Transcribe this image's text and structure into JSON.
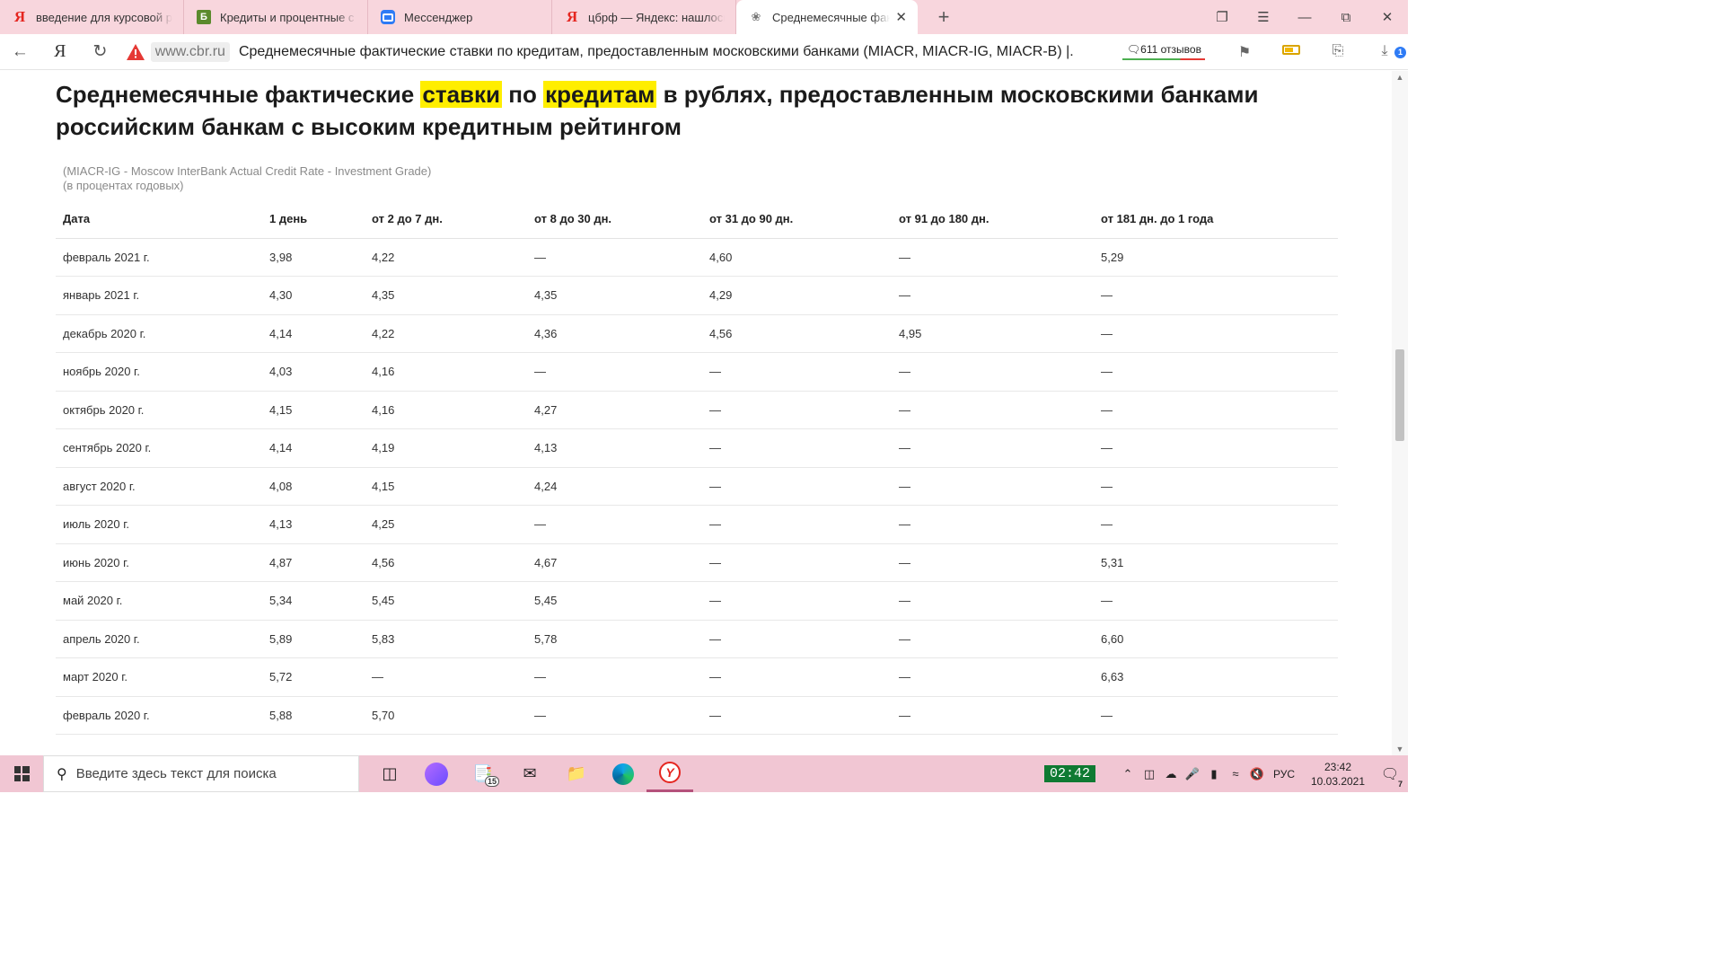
{
  "browser": {
    "tabs": [
      {
        "icon": "yandex-icon",
        "title": "введение для курсовой р",
        "active": false
      },
      {
        "icon": "banki-icon",
        "title": "Кредиты и процентные с",
        "active": false
      },
      {
        "icon": "messenger-icon",
        "title": "Мессенджер",
        "active": false
      },
      {
        "icon": "yandex-icon",
        "title": "цбрф — Яндекс: нашлось",
        "active": false
      },
      {
        "icon": "cbr-eagle-icon",
        "title": "Среднемесячные факт",
        "active": true
      }
    ],
    "new_tab_label": "+",
    "address": {
      "domain": "www.cbr.ru",
      "page_title": "Среднемесячные фактические ставки по кредитам, предоставленным московскими банками (MIACR, MIACR-IG, MIACR-B) |..."
    },
    "reviews_label": "611 отзывов"
  },
  "page": {
    "heading_parts": [
      "Среднемесячные фактические ",
      "ставки",
      " по ",
      "кредитам",
      " в рублях, предоставленным московскими банками российским банкам с высоким кредитным рейтингом"
    ],
    "subnote_line1": "(MIACR-IG - Moscow InterBank Actual Credit Rate - Investment Grade)",
    "subnote_line2": "(в процентах годовых)",
    "highlight_color": "#ffee00",
    "table": {
      "columns": [
        "Дата",
        "1 день",
        "от 2 до 7 дн.",
        "от 8 до 30 дн.",
        "от 31 до 90 дн.",
        "от 91 до 180 дн.",
        "от 181 дн. до 1 года"
      ],
      "rows": [
        [
          "февраль 2021 г.",
          "3,98",
          "4,22",
          "—",
          "4,60",
          "—",
          "5,29"
        ],
        [
          "январь 2021 г.",
          "4,30",
          "4,35",
          "4,35",
          "4,29",
          "—",
          "—"
        ],
        [
          "декабрь 2020 г.",
          "4,14",
          "4,22",
          "4,36",
          "4,56",
          "4,95",
          "—"
        ],
        [
          "ноябрь 2020 г.",
          "4,03",
          "4,16",
          "—",
          "—",
          "—",
          "—"
        ],
        [
          "октябрь 2020 г.",
          "4,15",
          "4,16",
          "4,27",
          "—",
          "—",
          "—"
        ],
        [
          "сентябрь 2020 г.",
          "4,14",
          "4,19",
          "4,13",
          "—",
          "—",
          "—"
        ],
        [
          "август 2020 г.",
          "4,08",
          "4,15",
          "4,24",
          "—",
          "—",
          "—"
        ],
        [
          "июль 2020 г.",
          "4,13",
          "4,25",
          "—",
          "—",
          "—",
          "—"
        ],
        [
          "июнь 2020 г.",
          "4,87",
          "4,56",
          "4,67",
          "—",
          "—",
          "5,31"
        ],
        [
          "май 2020 г.",
          "5,34",
          "5,45",
          "5,45",
          "—",
          "—",
          "—"
        ],
        [
          "апрель 2020 г.",
          "5,89",
          "5,83",
          "5,78",
          "—",
          "—",
          "6,60"
        ],
        [
          "март 2020 г.",
          "5,72",
          "—",
          "—",
          "—",
          "—",
          "6,63"
        ],
        [
          "февраль 2020 г.",
          "5,88",
          "5,70",
          "—",
          "—",
          "—",
          "—"
        ]
      ]
    }
  },
  "taskbar": {
    "search_placeholder": "Введите здесь текст для поиска",
    "explorer_badge": "15",
    "tray_timer": "02:42",
    "language": "РУС",
    "time": "23:42",
    "date": "10.03.2021",
    "notification_count": "7"
  }
}
